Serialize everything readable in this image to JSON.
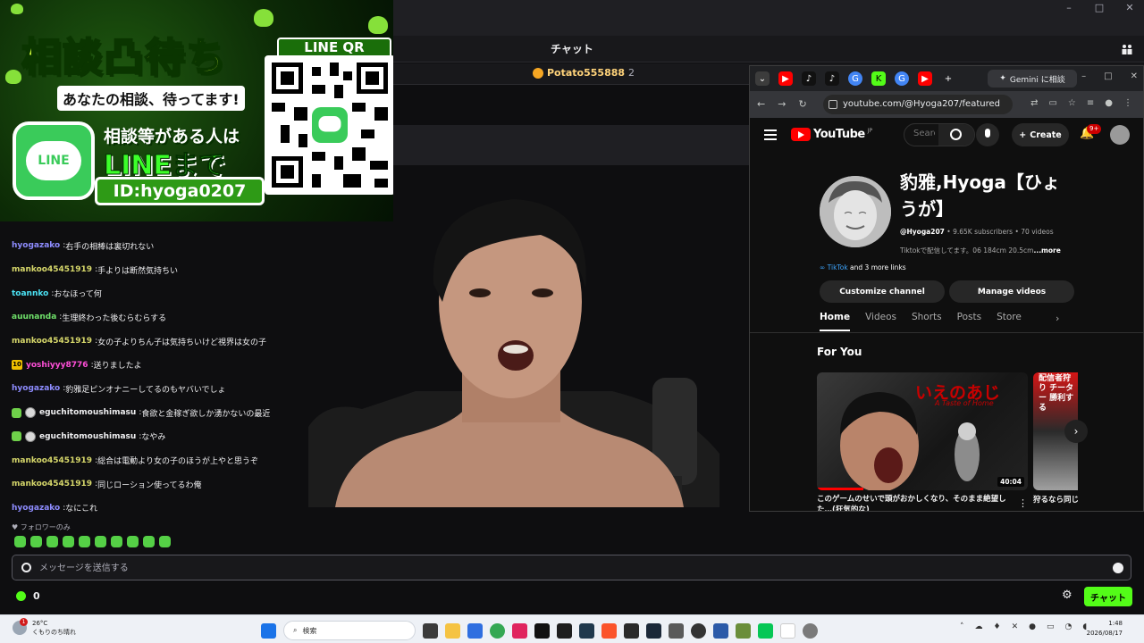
{
  "window": {
    "controls": [
      "–",
      "□",
      "✕"
    ]
  },
  "chat": {
    "title": "チャット",
    "gift_leader": {
      "name": "Potato555888",
      "count": "2"
    },
    "messages": [
      {
        "user": "hyogazako",
        "color": "#8e8cff",
        "text": "右手の相棒は裏切れない"
      },
      {
        "user": "mankoo45451919",
        "color": "#d7d86b",
        "text": "手よりは断然気持ちい"
      },
      {
        "user": "toannko",
        "color": "#4be3f5",
        "text": "おなほって何"
      },
      {
        "user": "auunanda",
        "color": "#6fe06a",
        "text": "生理終わった後むらむらする"
      },
      {
        "user": "mankoo45451919",
        "color": "#d7d86b",
        "text": "女の子よりちん子は気持ちいけど視界は女の子"
      },
      {
        "user": "yoshiyyy8776",
        "color": "#ff4fd8",
        "text": "送りましたよ",
        "badge": "10"
      },
      {
        "user": "hyogazako",
        "color": "#8e8cff",
        "text": "豹雅足ピンオナニーしてるのもヤバいでしょ"
      },
      {
        "user": "eguchitomoushimasu",
        "color": "#efeff1",
        "text": "食欲と金稼ぎ欲しか湧かないの最近",
        "sub": true
      },
      {
        "user": "eguchitomoushimasu",
        "color": "#efeff1",
        "text": "なやみ",
        "sub": true
      },
      {
        "user": "mankoo45451919",
        "color": "#d7d86b",
        "text": "総合は電動より女の子のほうが上やと思うぞ"
      },
      {
        "user": "mankoo45451919",
        "color": "#d7d86b",
        "text": "同じローション使ってるわ俺"
      },
      {
        "user": "hyogazako",
        "color": "#8e8cff",
        "text": "なにこれ"
      }
    ],
    "followers_only": "♥ フォロワーのみ",
    "input_placeholder": "メッセージを送信する",
    "points": "0",
    "send_label": "チャット"
  },
  "ad": {
    "title": "相談凸待ち",
    "subtitle": "あなたの相談、待ってます!",
    "line_logo": "LINE",
    "cta_line1": "相談等がある人は",
    "cta_line2": "LINEまで",
    "line_id": "ID:hyoga0207",
    "qr_label": "LINE QR"
  },
  "browser": {
    "gemini_tab": "Gemini に相談",
    "url": "youtube.com/@Hyoga207/featured",
    "youtube": {
      "logo": "YouTube",
      "region": "JP",
      "search_placeholder": "Search",
      "create_label": "Create",
      "notifications": "9+",
      "channel_name": "豹雅,Hyoga【ひょうが】",
      "handle": "@Hyoga207",
      "meta": " • 9.65K subscribers • 70 videos",
      "description": "Tiktokで配信してます。06 184cm 20.5cm",
      "more": "...more",
      "link_main": "TikTok",
      "link_more": " and 3 more links",
      "customize_label": "Customize channel",
      "manage_label": "Manage videos",
      "tabs": [
        "Home",
        "Videos",
        "Shorts",
        "Posts",
        "Store"
      ],
      "section": "For You",
      "video1": {
        "thumb_title": "いえのあじ",
        "thumb_sub": "A Taste of Home",
        "duration": "40:04",
        "caption": "このゲームのせいで頭がおかしくなり、そのまま絶望した…(狂気的な)"
      },
      "video2": {
        "thumb_title": "配信者狩り チーター 勝利する",
        "caption": "狩るなら同じ狩る方法"
      }
    }
  },
  "taskbar": {
    "weather_temp": "26°C",
    "weather_desc": "くもりのち晴れ",
    "weather_badge": "1",
    "search_label": "検索",
    "time": "1:48",
    "date": "2026/08/17"
  },
  "colors": {
    "kick_green": "#53fc18",
    "line_green": "#3acb5a",
    "youtube_red": "#ff0000"
  }
}
